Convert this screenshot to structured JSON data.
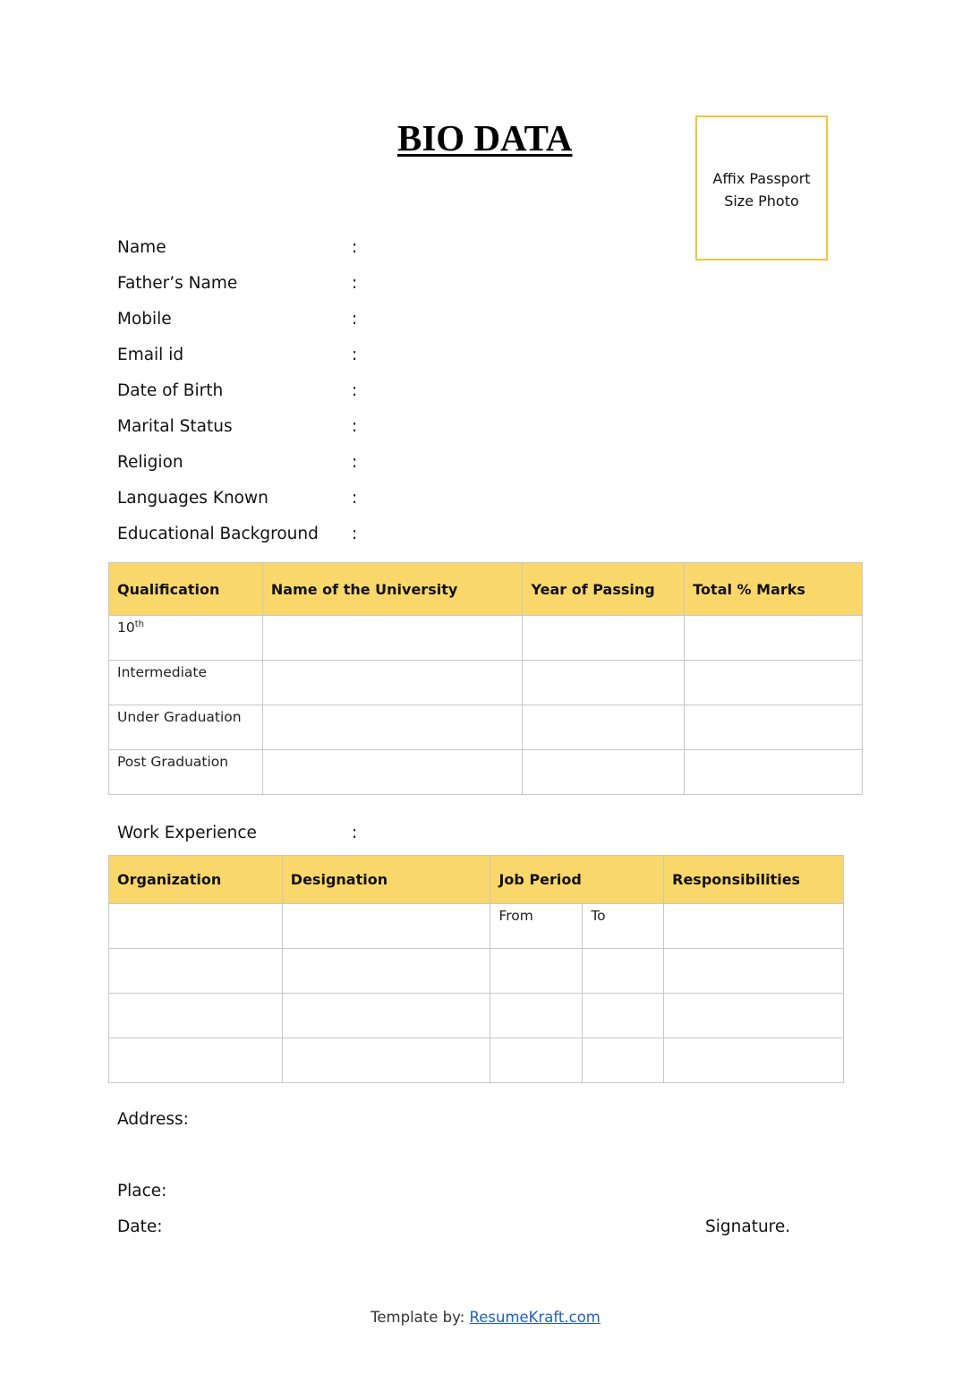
{
  "document": {
    "title": "BIO DATA",
    "photo_box": {
      "line1": "Affix Passport",
      "line2": "Size Photo"
    },
    "fields": [
      {
        "label": "Name",
        "separator": ":"
      },
      {
        "label": "Father’s Name",
        "separator": ":"
      },
      {
        "label": "Mobile",
        "separator": ":"
      },
      {
        "label": "Email id",
        "separator": ":"
      },
      {
        "label": "Date of Birth",
        "separator": ":"
      },
      {
        "label": "Marital Status",
        "separator": ":"
      },
      {
        "label": "Religion",
        "separator": ":"
      },
      {
        "label": "Languages Known",
        "separator": ":"
      },
      {
        "label": "Educational Background",
        "separator": ":"
      }
    ],
    "education_table": {
      "headers": [
        "Qualification",
        "Name of the University",
        "Year of Passing",
        "Total % Marks"
      ],
      "rows": [
        {
          "qualification": "10",
          "superscript": "th"
        },
        {
          "qualification": "Intermediate",
          "superscript": ""
        },
        {
          "qualification": "Under Graduation",
          "superscript": ""
        },
        {
          "qualification": "Post Graduation",
          "superscript": ""
        }
      ]
    },
    "work_experience": {
      "label": "Work Experience",
      "separator": ":",
      "headers": [
        "Organization",
        "Designation",
        "Job Period",
        "Responsibilities"
      ],
      "sub_headers": {
        "from": "From",
        "to": "To"
      }
    },
    "address_label": "Address:",
    "place_label": "Place:",
    "date_label": "Date:",
    "signature_label": "Signature.",
    "footer": {
      "prefix": "Template by: ",
      "link_text": "ResumeKraft.com"
    }
  },
  "colors": {
    "header_fill": "#fad76a",
    "photo_border": "#f5c33a",
    "link": "#1f5fbf"
  }
}
